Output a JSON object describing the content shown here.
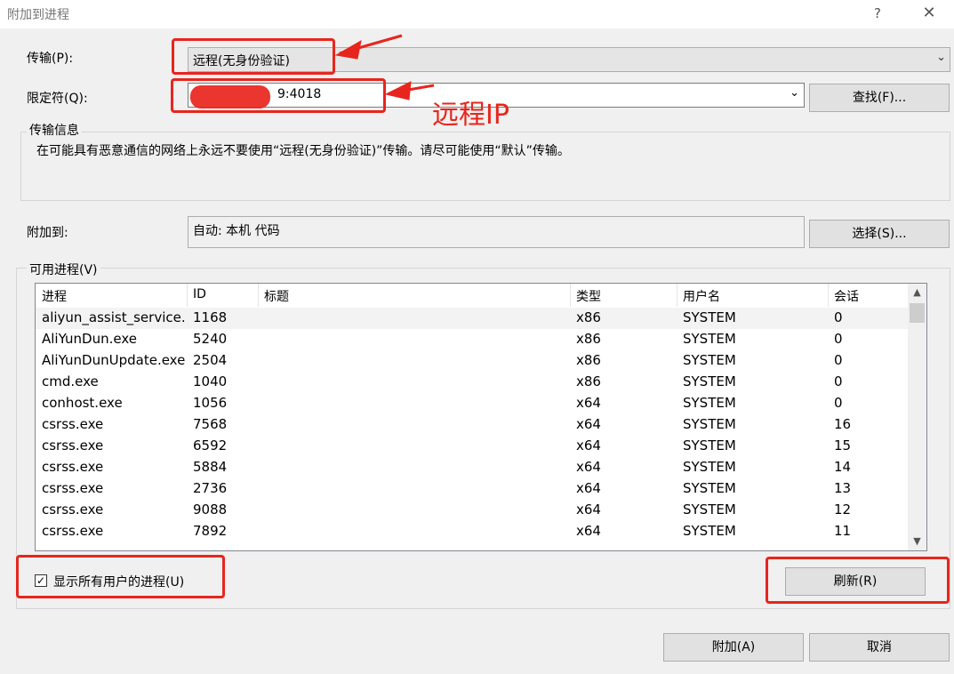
{
  "dialog": {
    "title": "附加到进程",
    "help_glyph": "?",
    "close_glyph": "✕"
  },
  "transport": {
    "label": "传输(P):",
    "value": "远程(无身份验证)"
  },
  "qualifier": {
    "label": "限定符(Q):",
    "value_visible": "9:4018",
    "find_button": "查找(F)..."
  },
  "transport_info": {
    "heading": "传输信息",
    "text": "在可能具有恶意通信的网络上永远不要使用“远程(无身份验证)”传输。请尽可能使用“默认”传输。"
  },
  "attach_to": {
    "label": "附加到:",
    "value": "自动: 本机 代码",
    "select_button": "选择(S)..."
  },
  "processes": {
    "heading": "可用进程(V)",
    "columns": [
      "进程",
      "ID",
      "标题",
      "类型",
      "用户名",
      "会话"
    ],
    "rows": [
      [
        "aliyun_assist_service.",
        "1168",
        "",
        "x86",
        "SYSTEM",
        "0"
      ],
      [
        "AliYunDun.exe",
        "5240",
        "",
        "x86",
        "SYSTEM",
        "0"
      ],
      [
        "AliYunDunUpdate.exe",
        "2504",
        "",
        "x86",
        "SYSTEM",
        "0"
      ],
      [
        "cmd.exe",
        "1040",
        "",
        "x86",
        "SYSTEM",
        "0"
      ],
      [
        "conhost.exe",
        "1056",
        "",
        "x64",
        "SYSTEM",
        "0"
      ],
      [
        "csrss.exe",
        "7568",
        "",
        "x64",
        "SYSTEM",
        "16"
      ],
      [
        "csrss.exe",
        "6592",
        "",
        "x64",
        "SYSTEM",
        "15"
      ],
      [
        "csrss.exe",
        "5884",
        "",
        "x64",
        "SYSTEM",
        "14"
      ],
      [
        "csrss.exe",
        "2736",
        "",
        "x64",
        "SYSTEM",
        "13"
      ],
      [
        "csrss.exe",
        "9088",
        "",
        "x64",
        "SYSTEM",
        "12"
      ],
      [
        "csrss.exe",
        "7892",
        "",
        "x64",
        "SYSTEM",
        "11"
      ]
    ],
    "show_all_users_label": "显示所有用户的进程(U)",
    "show_all_users_checked": true,
    "refresh_button": "刷新(R)"
  },
  "footer": {
    "attach_button": "附加(A)",
    "cancel_button": "取消"
  },
  "annotation": {
    "remote_ip_label": "远程IP",
    "color": "#e8251c"
  }
}
